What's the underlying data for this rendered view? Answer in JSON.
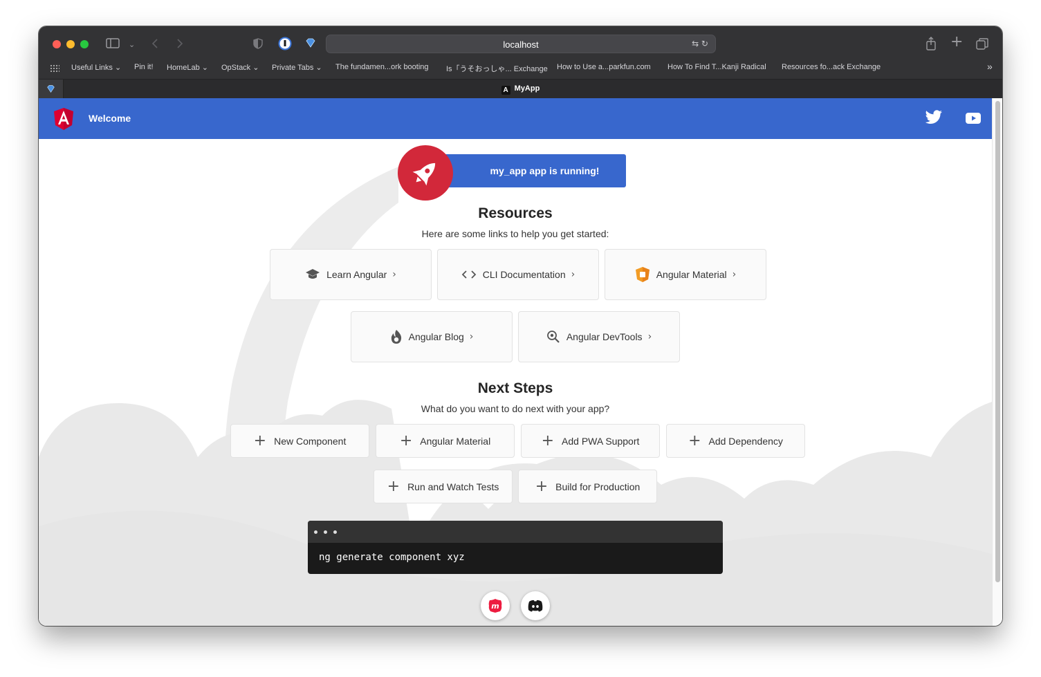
{
  "browser": {
    "url": "localhost",
    "bookmarks": [
      "Useful Links",
      "Pin it!",
      "HomeLab",
      "OpStack",
      "Private Tabs",
      "The fundamen...ork booting",
      "Is「うそおっしゃ... Exchange",
      "How to Use a...parkfun.com",
      "How To Find T...Kanji Radical",
      "Resources fo...ack Exchange"
    ],
    "tab_title": "MyApp",
    "tab_logo": "A"
  },
  "toolbar": {
    "title": "Welcome",
    "logo_letter": "A"
  },
  "banner": {
    "text": "my_app app is running!"
  },
  "resources": {
    "heading": "Resources",
    "subtitle": "Here are some links to help you get started:",
    "cards": [
      {
        "label": "Learn Angular",
        "icon": "graduation-cap-icon"
      },
      {
        "label": "CLI Documentation",
        "icon": "code-brackets-icon"
      },
      {
        "label": "Angular Material",
        "icon": "material-shield-icon"
      },
      {
        "label": "Angular Blog",
        "icon": "flame-icon"
      },
      {
        "label": "Angular DevTools",
        "icon": "magnifier-icon"
      }
    ]
  },
  "next_steps": {
    "heading": "Next Steps",
    "subtitle": "What do you want to do next with your app?",
    "steps": [
      "New Component",
      "Angular Material",
      "Add PWA Support",
      "Add Dependency",
      "Run and Watch Tests",
      "Build for Production"
    ]
  },
  "terminal": {
    "command": "ng generate component xyz"
  },
  "colors": {
    "toolbar": "#3867cd",
    "rocket": "#d2283a",
    "browser_chrome": "#333335"
  }
}
